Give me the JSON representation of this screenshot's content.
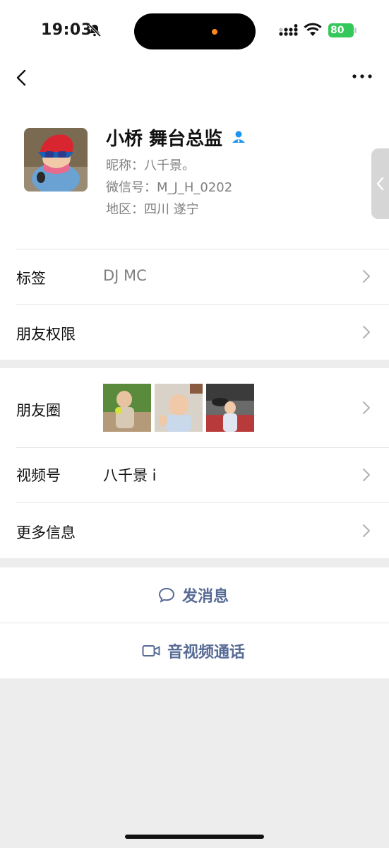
{
  "status_bar": {
    "time": "19:03",
    "battery": "80"
  },
  "profile": {
    "name": "小桥 舞台总监",
    "nickname": "昵称：八千景。",
    "wechat_id": "微信号：M_J_H_0202",
    "region": "地区：四川 遂宁"
  },
  "rows": {
    "tag_label": "标签",
    "tag_value": "DJ MC",
    "permissions_label": "朋友权限",
    "moments_label": "朋友圈",
    "channels_label": "视频号",
    "channels_value": "八千景 i",
    "more_label": "更多信息"
  },
  "actions": {
    "message": "发消息",
    "call": "音视频通话"
  },
  "colors": {
    "link": "#576b95",
    "battery": "#34c759",
    "verify": "#1e96f0"
  }
}
